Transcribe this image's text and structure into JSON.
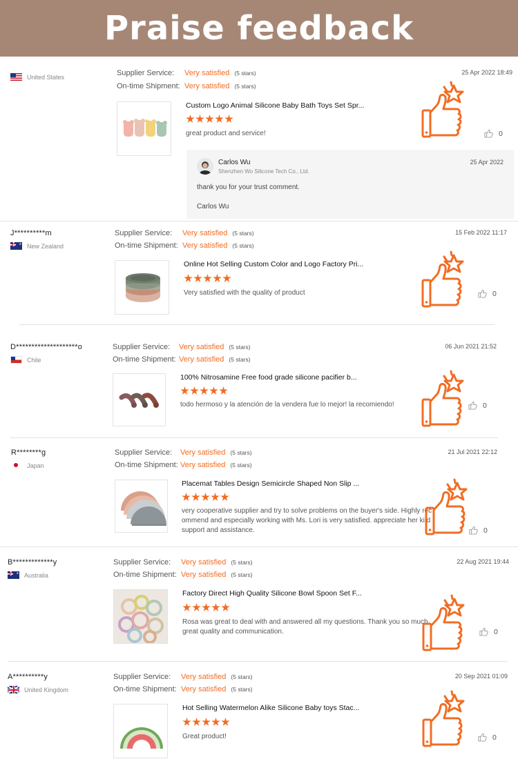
{
  "page": {
    "title": "Praise feedback",
    "accent_color": "#f26c22",
    "banner_color": "#a68776"
  },
  "labels": {
    "supplier_service": "Supplier Service:",
    "ontime_shipment": "On-time Shipment:",
    "star_note": "(5 stars)"
  },
  "reviews": [
    {
      "buyer": "",
      "country": "United States",
      "flag_icon": "us-flag-icon",
      "supplier_service": "Very satisfied",
      "ontime_shipment": "Very satisfied",
      "date": "25 Apr 2022 18:49",
      "product_title": "Custom Logo Animal Silicone Baby Bath Toys Set Spr...",
      "rating": 5,
      "comment": "great product and service!",
      "likes": "0",
      "reply": {
        "name": "Carlos Wu",
        "company": "Shenzhen Wo Silicone Tech Co., Ltd.",
        "date": "25 Apr 2022",
        "text": "thank you for your trust comment.",
        "signature": "Carlos Wu"
      }
    },
    {
      "buyer": "J**********m",
      "country": "New Zealand",
      "flag_icon": "nz-flag-icon",
      "supplier_service": "Very satisfied",
      "ontime_shipment": "Very satisfied",
      "date": "15 Feb 2022 11:17",
      "product_title": "Online Hot Selling Custom Color and Logo Factory Pri...",
      "rating": 5,
      "comment": "Very satisfied with the quality of product",
      "likes": "0"
    },
    {
      "buyer": "D********************o",
      "country": "Chile",
      "flag_icon": "chile-flag-icon",
      "supplier_service": "Very satisfied",
      "ontime_shipment": "Very satisfied",
      "date": "06 Jun 2021 21:52",
      "product_title": "100% Nitrosamine Free food grade silicone pacifier b...",
      "rating": 5,
      "comment": "todo hermoso y la atención de la vendera fue lo mejor! la recomiendo!",
      "likes": "0"
    },
    {
      "buyer": "R********g",
      "country": "Japan",
      "flag_icon": "japan-flag-icon",
      "supplier_service": "Very satisfied",
      "ontime_shipment": "Very satisfied",
      "date": "21 Jul 2021 22:12",
      "product_title": "Placemat Tables Design Semicircle Shaped Non Slip ...",
      "rating": 5,
      "comment": "very cooperative supplier and try to solve problems on the buyer's side. Highly rec ommend and especially working with Ms. Lori is very satisfied. appreciate her ki d support and assistance.",
      "likes": "0"
    },
    {
      "buyer": "B*************y",
      "country": "Australia",
      "flag_icon": "australia-flag-icon",
      "supplier_service": "Very satisfied",
      "ontime_shipment": "Very satisfied",
      "date": "22 Aug 2021 19:44",
      "product_title": "Factory Direct High Quality Silicone Bowl Spoon Set F...",
      "rating": 5,
      "comment": "Rosa was great to deal with and answered all my questions. Thank you so much great quality and communication.",
      "likes": "0"
    },
    {
      "buyer": "A**********y",
      "country": "United Kingdom",
      "flag_icon": "uk-flag-icon",
      "supplier_service": "Very satisfied",
      "ontime_shipment": "Very satisfied",
      "date": "20 Sep 2021 01:09",
      "product_title": "Hot Selling Watermelon Alike Silicone Baby toys Stac...",
      "rating": 5,
      "comment": "Great product!",
      "likes": "0"
    }
  ]
}
